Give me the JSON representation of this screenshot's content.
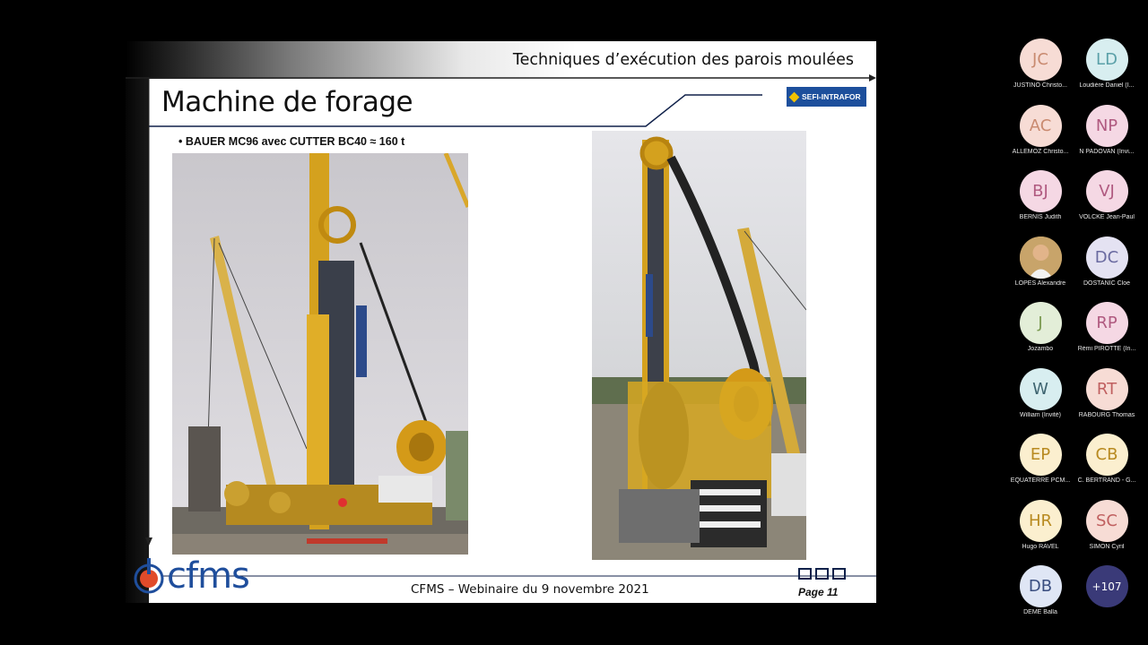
{
  "slide": {
    "section_title": "Techniques d’exécution des parois moulées",
    "title": "Machine de forage",
    "brand_logo": "SEFI-INTRAFOR",
    "bullet": "BAUER MC96 avec CUTTER BC40 ≈ 160 t",
    "footer_logo": "cfms",
    "footer_text": "CFMS – Webinaire du 9 novembre 2021",
    "page_number": "Page 11"
  },
  "participants": [
    {
      "initials": "JC",
      "name": "JUSTINO Christo...",
      "color": "#f7dcd5",
      "text_color": "#c98a70"
    },
    {
      "initials": "LD",
      "name": "Loudière Daniel (I...",
      "color": "#d8eef0",
      "text_color": "#5aa0a8"
    },
    {
      "initials": "AC",
      "name": "ALLEMOZ Christo...",
      "color": "#f7dcd5",
      "text_color": "#c98a70"
    },
    {
      "initials": "NP",
      "name": "N PADOVAN (Invi...",
      "color": "#f5d8e4",
      "text_color": "#b05a80"
    },
    {
      "initials": "BJ",
      "name": "BERNIS Judith",
      "color": "#f5d8e4",
      "text_color": "#b05a80"
    },
    {
      "initials": "VJ",
      "name": "VOLCKE Jean-Paul",
      "color": "#f5d8e4",
      "text_color": "#b05a80"
    },
    {
      "initials": "",
      "name": "LOPES Alexandre",
      "color": "#c8a46a",
      "text_color": "#fff",
      "photo": true
    },
    {
      "initials": "DC",
      "name": "DOSTANIC Cloe",
      "color": "#e4e2f2",
      "text_color": "#6a6aa0"
    },
    {
      "initials": "J",
      "name": "Jozambo",
      "color": "#e3eed8",
      "text_color": "#7a9a50"
    },
    {
      "initials": "RP",
      "name": "Rémi PIROTTE (In...",
      "color": "#f5d8e4",
      "text_color": "#b05a80"
    },
    {
      "initials": "W",
      "name": "William (Invité)",
      "color": "#d8eef0",
      "text_color": "#3e6470"
    },
    {
      "initials": "RT",
      "name": "RABOURG Thomas",
      "color": "#f7dcd5",
      "text_color": "#c06060"
    },
    {
      "initials": "EP",
      "name": "EQUATERRE PCM...",
      "color": "#fbefcf",
      "text_color": "#b88a20"
    },
    {
      "initials": "CB",
      "name": "C. BERTRAND - G...",
      "color": "#fbefcf",
      "text_color": "#b88a20"
    },
    {
      "initials": "HR",
      "name": "Hugo RAVEL",
      "color": "#fbefcf",
      "text_color": "#b88a20"
    },
    {
      "initials": "SC",
      "name": "SIMON Cyril",
      "color": "#f7dcd5",
      "text_color": "#c06060"
    },
    {
      "initials": "DB",
      "name": "DEME Balla",
      "color": "#dfe6f5",
      "text_color": "#3a4e80"
    },
    {
      "initials": "+107",
      "name": "",
      "color": "#3a3a78",
      "text_color": "#fff"
    }
  ]
}
